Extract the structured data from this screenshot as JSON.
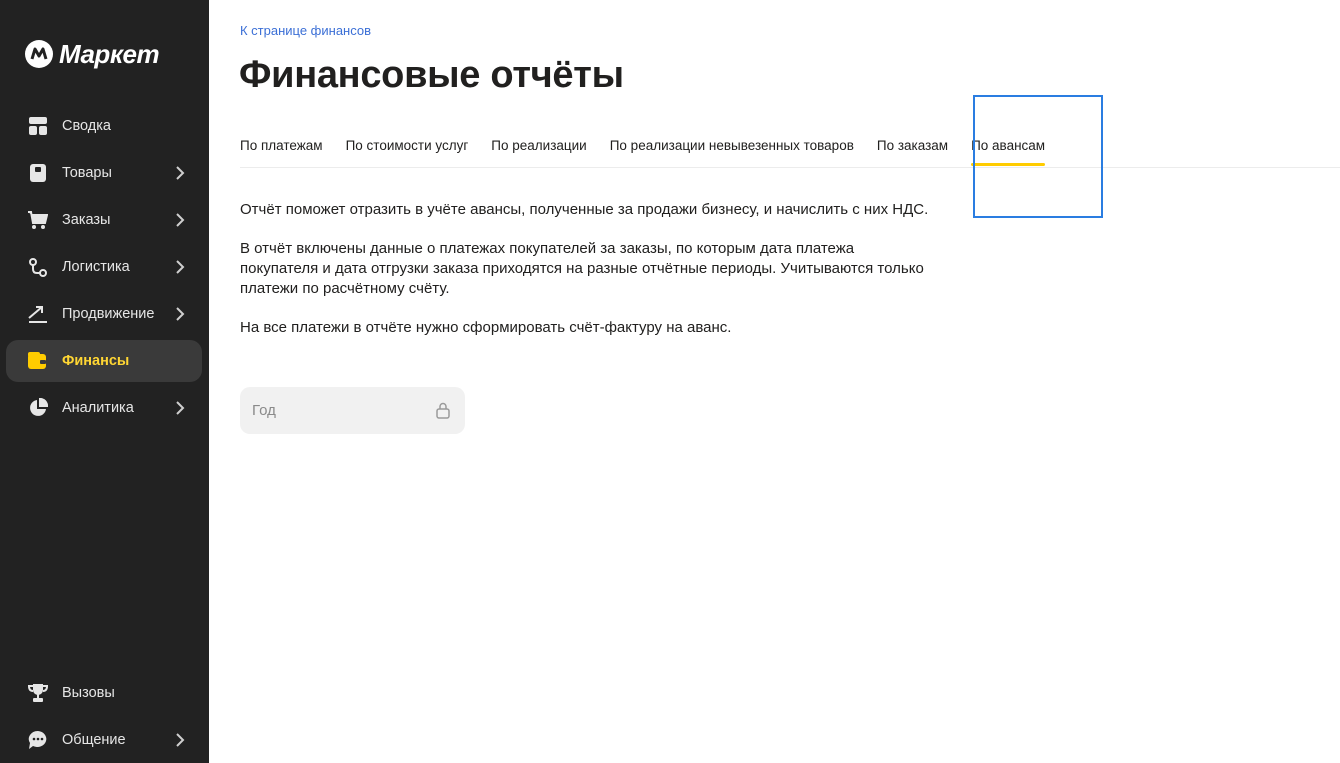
{
  "brand": {
    "name": "Маркет",
    "accent": "#ffcc00"
  },
  "sidebar": {
    "items": [
      {
        "label": "Сводка",
        "icon": "dashboard-icon",
        "chevron": false
      },
      {
        "label": "Товары",
        "icon": "box-icon",
        "chevron": true
      },
      {
        "label": "Заказы",
        "icon": "cart-icon",
        "chevron": true
      },
      {
        "label": "Логистика",
        "icon": "route-icon",
        "chevron": true
      },
      {
        "label": "Продвижение",
        "icon": "trend-icon",
        "chevron": true
      },
      {
        "label": "Финансы",
        "icon": "wallet-icon",
        "chevron": false,
        "active": true
      },
      {
        "label": "Аналитика",
        "icon": "pie-chart-icon",
        "chevron": true
      }
    ],
    "bottom_items": [
      {
        "label": "Вызовы",
        "icon": "trophy-icon",
        "chevron": false
      },
      {
        "label": "Общение",
        "icon": "chat-icon",
        "chevron": true
      }
    ]
  },
  "header": {
    "breadcrumb": "К странице финансов",
    "title": "Финансовые отчёты"
  },
  "tabs": [
    {
      "label": "По платежам"
    },
    {
      "label": "По стоимости услуг"
    },
    {
      "label": "По реализации"
    },
    {
      "label": "По реализации невывезенных товаров"
    },
    {
      "label": "По заказам"
    },
    {
      "label": "По авансам",
      "active": true
    }
  ],
  "content": {
    "paragraphs": [
      "Отчёт поможет отразить в учёте авансы, полученные за продажи бизнесу, и начислить с них НДС.",
      "В отчёт включены данные о платежах покупателей за заказы, по которым дата платежа покупателя и дата отгрузки заказа приходятся на разные отчётные периоды. Учитываются только платежи по расчётному счёту.",
      "На все платежи в отчёте нужно сформировать счёт-фактуру на аванс."
    ]
  },
  "year_select": {
    "label": "Год",
    "icon": "lock-icon"
  }
}
